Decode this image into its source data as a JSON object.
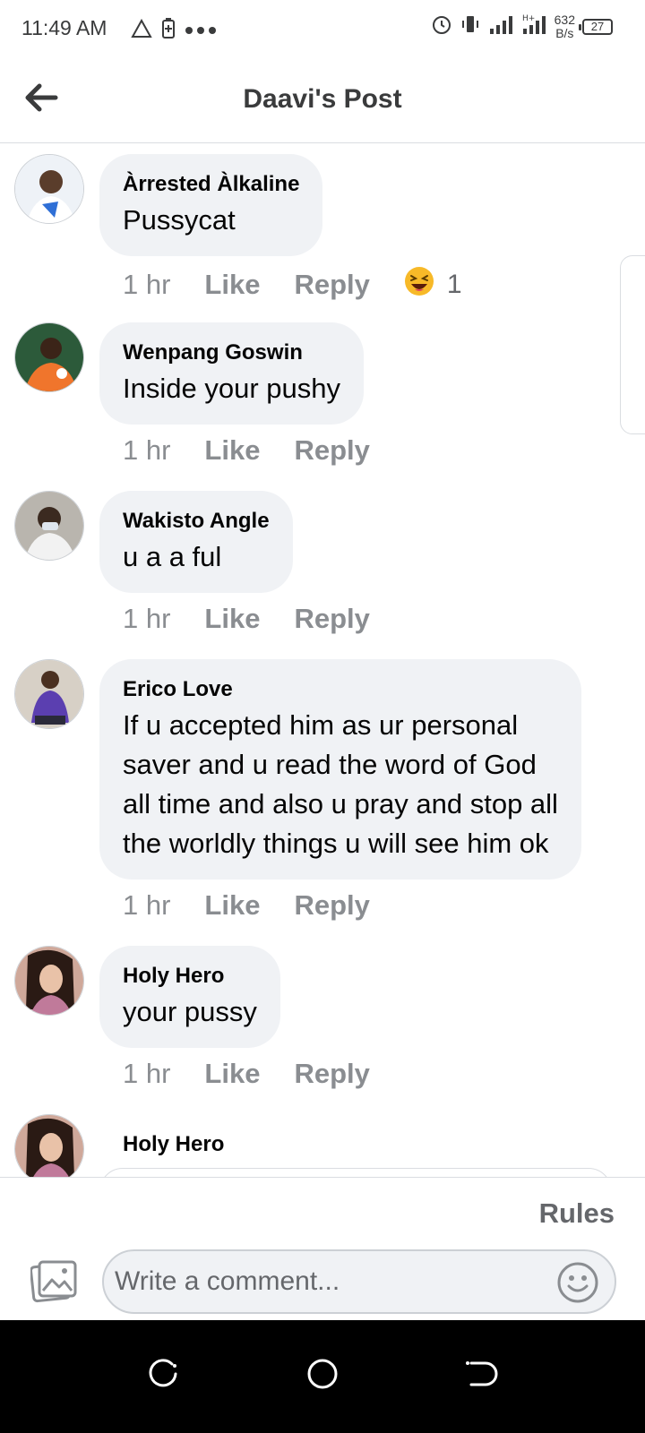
{
  "status_bar": {
    "time": "11:49 AM",
    "net_speed_value": "632",
    "net_speed_unit": "B/s",
    "battery": "27"
  },
  "header": {
    "title": "Daavi's Post"
  },
  "comments": [
    {
      "author": "Àrrested Àlkaline",
      "text": "Pussycat",
      "time": "1 hr",
      "like": "Like",
      "reply": "Reply",
      "reaction_icon": "laughing-emoji",
      "reaction_count": "1"
    },
    {
      "author": "Wenpang Goswin",
      "text": "Inside your pushy",
      "time": "1 hr",
      "like": "Like",
      "reply": "Reply"
    },
    {
      "author": "Wakisto Angle",
      "text": "u a a ful",
      "time": "1 hr",
      "like": "Like",
      "reply": "Reply"
    },
    {
      "author": "Erico Love",
      "text_lines": [
        "If u accepted him as ur personal",
        "saver and u read the word of God",
        "all time and also u pray and stop all",
        "the worldly things u will see him ok"
      ],
      "time": "1 hr",
      "like": "Like",
      "reply": "Reply"
    },
    {
      "author": "Holy Hero",
      "text": "your pussy",
      "time": "1 hr",
      "like": "Like",
      "reply": "Reply"
    },
    {
      "author": "Holy Hero"
    }
  ],
  "footer": {
    "rules_label": "Rules",
    "comment_placeholder": "Write a comment...",
    "icons": [
      "photo-icon",
      "emoji-icon"
    ]
  },
  "nav_bar": {
    "icons": [
      "recent-apps-icon",
      "home-icon",
      "back-icon"
    ]
  },
  "colors": {
    "bubble_bg": "#f0f2f5",
    "meta_text": "#8a8d91",
    "title_text": "#3a3b3c"
  }
}
